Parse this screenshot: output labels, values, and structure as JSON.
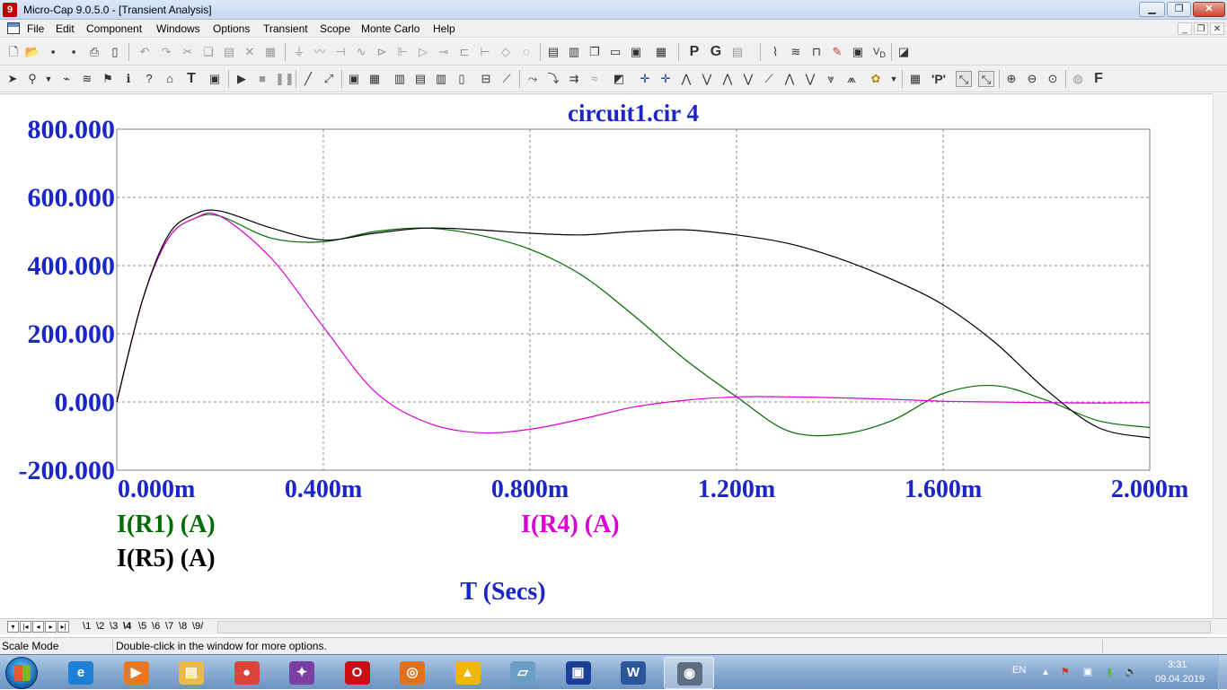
{
  "window": {
    "app_icon": "microcap-logo-icon",
    "title": "Micro-Cap 9.0.5.0 - [Transient Analysis]",
    "min_label": "▁",
    "max_label": "❐",
    "close_label": "✕"
  },
  "menu": {
    "items": [
      "File",
      "Edit",
      "Component",
      "Windows",
      "Options",
      "Transient",
      "Scope",
      "Monte Carlo",
      "Help"
    ],
    "mdi_min": "_",
    "mdi_restore": "❐",
    "mdi_close": "✕"
  },
  "toolbar1": {
    "icons": [
      "new-icon",
      "open-icon",
      "save-icon",
      "save-all-icon",
      "print-icon",
      "print-preview-icon",
      "undo-icon",
      "redo-icon",
      "cut-icon",
      "copy-icon",
      "paste-icon",
      "delete-icon",
      "select-all-icon",
      "ground-icon",
      "resistor-icon",
      "capacitor-icon",
      "inductor-icon",
      "diode-icon",
      "battery-icon",
      "opamp-icon",
      "switch-icon",
      "npn-icon",
      "pnp-icon",
      "gate-icon",
      "tile-horizontal-icon",
      "tile-vertical-icon",
      "cascade-icon",
      "window-icon",
      "properties-icon",
      "calculator-icon",
      "preferences-icon",
      "text-icon",
      "graph-icon",
      "table-icon",
      "waveform-icon",
      "pulse-icon",
      "probe-icon",
      "marker-icon",
      "scope-icon",
      "vd-icon",
      "analysis-icon"
    ],
    "p_label": "P",
    "g_label": "G"
  },
  "toolbar2": {
    "icons": [
      "select-arrow-icon",
      "component-icon",
      "wire-icon",
      "bus-icon",
      "text-tool-icon",
      "flag-icon",
      "info-icon",
      "help-icon",
      "run-icon",
      "stop-icon",
      "pause-icon",
      "line-icon",
      "diagonal-icon",
      "grid-icon",
      "minor-grid-icon",
      "axes-icon",
      "tokens-icon",
      "peak-icon",
      "valley-icon",
      "high-icon",
      "low-icon",
      "inflection-icon",
      "slope-icon",
      "zoom-in-icon",
      "zoom-out-icon",
      "zoom-fit-icon",
      "scope-settings-icon",
      "font-icon"
    ],
    "t_label": "T",
    "f_label": "F",
    "pp_label": "'P'"
  },
  "plot": {
    "title": "circuit1.cir 4",
    "x_axis_label": "T (Secs)",
    "legend": [
      {
        "label": "I(R1) (A)",
        "color": "#006c00"
      },
      {
        "label": "I(R4) (A)",
        "color": "#d800d8"
      },
      {
        "label": "I(R5) (A)",
        "color": "#000000"
      }
    ]
  },
  "chart_data": {
    "type": "line",
    "title": "circuit1.cir 4",
    "xlabel": "T (Secs)",
    "ylabel": "",
    "xlim": [
      0,
      0.002
    ],
    "ylim": [
      -200,
      800
    ],
    "x_ticks": [
      "0.000m",
      "0.400m",
      "0.800m",
      "1.200m",
      "1.600m",
      "2.000m"
    ],
    "y_ticks": [
      "800.000",
      "600.000",
      "400.000",
      "200.000",
      "0.000",
      "-200.000"
    ],
    "grid": true,
    "x": [
      0,
      5e-05,
      0.0001,
      0.00015,
      0.0002,
      0.0003,
      0.0004,
      0.0005,
      0.0006,
      0.0007,
      0.0008,
      0.0009,
      0.001,
      0.0011,
      0.0012,
      0.0013,
      0.0014,
      0.0015,
      0.0016,
      0.0017,
      0.0018,
      0.0019,
      0.002
    ],
    "series": [
      {
        "name": "I(R1) (A)",
        "color": "#006c00",
        "values": [
          0,
          300,
          480,
          538,
          545,
          480,
          470,
          500,
          510,
          490,
          448,
          372,
          255,
          125,
          15,
          -85,
          -95,
          -55,
          25,
          48,
          5,
          -55,
          -75
        ]
      },
      {
        "name": "I(R4) (A)",
        "color": "#d800d8",
        "values": [
          0,
          300,
          480,
          538,
          545,
          420,
          220,
          30,
          -60,
          -90,
          -80,
          -50,
          -15,
          5,
          15,
          15,
          12,
          8,
          2,
          0,
          -2,
          -3,
          -2
        ]
      },
      {
        "name": "I(R5) (A)",
        "color": "#000000",
        "values": [
          0,
          300,
          490,
          550,
          560,
          510,
          475,
          495,
          510,
          505,
          495,
          490,
          500,
          505,
          490,
          465,
          420,
          360,
          285,
          175,
          35,
          -75,
          -105
        ]
      }
    ]
  },
  "tabs": {
    "items": [
      "1",
      "2",
      "3",
      "4",
      "5",
      "6",
      "7",
      "8",
      "9"
    ],
    "active_index": 3
  },
  "status": {
    "mode": "Scale Mode",
    "hint": "Double-click in the window for more options."
  },
  "taskbar": {
    "apps": [
      {
        "name": "internet-explorer-icon",
        "color": "#1e7fd6",
        "glyph": "e"
      },
      {
        "name": "media-player-icon",
        "color": "#e87722",
        "glyph": "▶"
      },
      {
        "name": "file-explorer-icon",
        "color": "#e9b949",
        "glyph": "▤"
      },
      {
        "name": "chrome-icon",
        "color": "#db4437",
        "glyph": "●"
      },
      {
        "name": "app-bird-icon",
        "color": "#7a3fa0",
        "glyph": "✦"
      },
      {
        "name": "opera-icon",
        "color": "#cc0f16",
        "glyph": "O"
      },
      {
        "name": "app-swirl-icon",
        "color": "#e0701a",
        "glyph": "◎"
      },
      {
        "name": "app-triangle-icon",
        "color": "#f2b705",
        "glyph": "▲"
      },
      {
        "name": "app-notebook-icon",
        "color": "#6a9ec4",
        "glyph": "▱"
      },
      {
        "name": "floppy-save-icon",
        "color": "#1c3f9a",
        "glyph": "▣"
      },
      {
        "name": "word-icon",
        "color": "#2b579a",
        "glyph": "W"
      },
      {
        "name": "microcap-task-icon",
        "color": "#5c6f82",
        "glyph": "◉"
      }
    ],
    "active_app_index": 11,
    "lang": "EN",
    "time": "3:31",
    "date": "09.04.2019"
  }
}
